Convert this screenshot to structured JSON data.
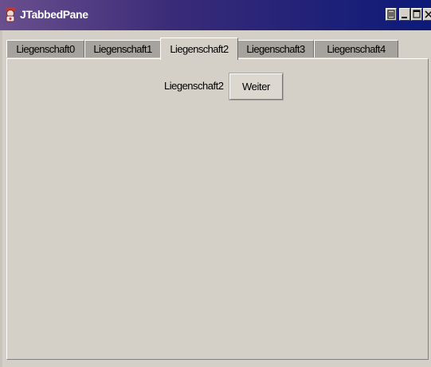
{
  "window": {
    "title": "JTabbedPane",
    "icons": [
      "java-duke-icon",
      "restore-icon",
      "minimize-icon",
      "maximize-icon",
      "close-icon"
    ]
  },
  "tabs": [
    {
      "label": "Liegenschaft0",
      "selected": false
    },
    {
      "label": "Liegenschaft1",
      "selected": false
    },
    {
      "label": "Liegenschaft2",
      "selected": true
    },
    {
      "label": "Liegenschaft3",
      "selected": false
    },
    {
      "label": "Liegenschaft4",
      "selected": false
    }
  ],
  "content": {
    "label": "Liegenschaft2",
    "button_label": "Weiter"
  },
  "colors": {
    "titlebar_start": "#6a4f8e",
    "titlebar_end": "#0c1a78",
    "panel": "#d4d0c8",
    "inactive_tab": "#a6a29e"
  }
}
